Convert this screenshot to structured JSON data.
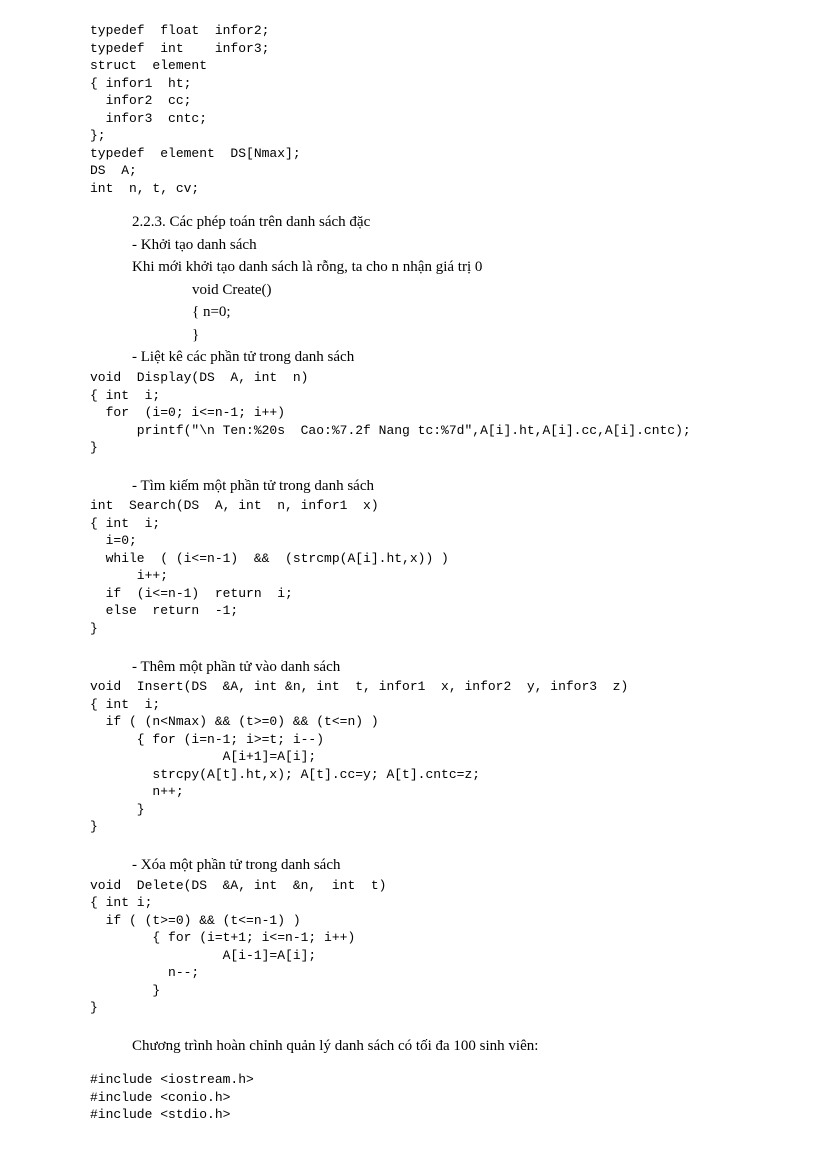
{
  "code_top": "typedef  float  infor2;\ntypedef  int    infor3;\nstruct  element\n{ infor1  ht;\n  infor2  cc;\n  infor3  cntc;\n};\ntypedef  element  DS[Nmax];\nDS  A;\nint  n, t, cv;",
  "sec_223": "2.2.3.  Các phép toán trên danh sách đặc",
  "khoi_tao": "- Khởi tạo danh sách",
  "khoi_tao_desc": "Khi mới khởi tạo danh sách là rỗng, ta cho n nhận giá trị 0",
  "create_line1": "void  Create()",
  "create_line2": "{ n=0;",
  "create_line3": "}",
  "liet_ke": "- Liệt kê các phần tử trong danh sách",
  "code_display": "void  Display(DS  A, int  n)\n{ int  i;\n  for  (i=0; i<=n-1; i++)\n      printf(\"\\n Ten:%20s  Cao:%7.2f Nang tc:%7d\",A[i].ht,A[i].cc,A[i].cntc);\n}",
  "tim_kiem": "- Tìm kiếm một phần tử trong danh sách",
  "code_search": "int  Search(DS  A, int  n, infor1  x)\n{ int  i;\n  i=0;\n  while  ( (i<=n-1)  &&  (strcmp(A[i].ht,x)) )\n      i++;\n  if  (i<=n-1)  return  i;\n  else  return  -1;\n}",
  "them": "- Thêm một phần tử vào danh sách",
  "code_insert": "void  Insert(DS  &A, int &n, int  t, infor1  x, infor2  y, infor3  z)\n{ int  i;\n  if ( (n<Nmax) && (t>=0) && (t<=n) )\n      { for (i=n-1; i>=t; i--)\n                 A[i+1]=A[i];\n        strcpy(A[t].ht,x); A[t].cc=y; A[t].cntc=z;\n        n++;\n      }\n}",
  "xoa": "- Xóa một phần tử trong danh sách",
  "code_delete": "void  Delete(DS  &A, int  &n,  int  t)\n{ int i;\n  if ( (t>=0) && (t<=n-1) )\n        { for (i=t+1; i<=n-1; i++)\n                 A[i-1]=A[i];\n          n--;\n        }\n}",
  "prog_title": "Chương trình hoàn chỉnh quản lý danh sách có tối đa 100 sinh viên:",
  "code_includes": "#include <iostream.h>\n#include <conio.h>\n#include <stdio.h>"
}
